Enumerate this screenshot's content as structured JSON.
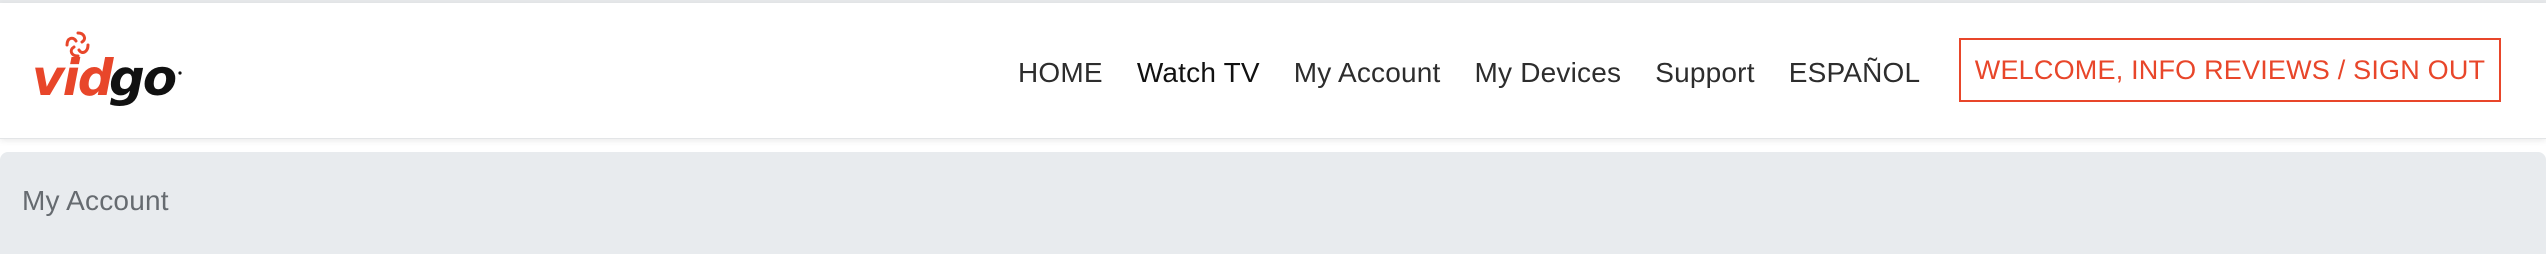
{
  "brand": {
    "name": "vidgo",
    "colors": {
      "primary": "#e8462a",
      "dark": "#111111",
      "background": "#ffffff",
      "panel": "#e8ebee"
    }
  },
  "nav": {
    "items": [
      {
        "label": "HOME"
      },
      {
        "label": "Watch TV"
      },
      {
        "label": "My Account"
      },
      {
        "label": "My Devices"
      },
      {
        "label": "Support"
      },
      {
        "label": "ESPAÑOL"
      }
    ],
    "account_button": "WELCOME, INFO REVIEWS / SIGN OUT"
  },
  "page": {
    "breadcrumb": "My Account"
  }
}
